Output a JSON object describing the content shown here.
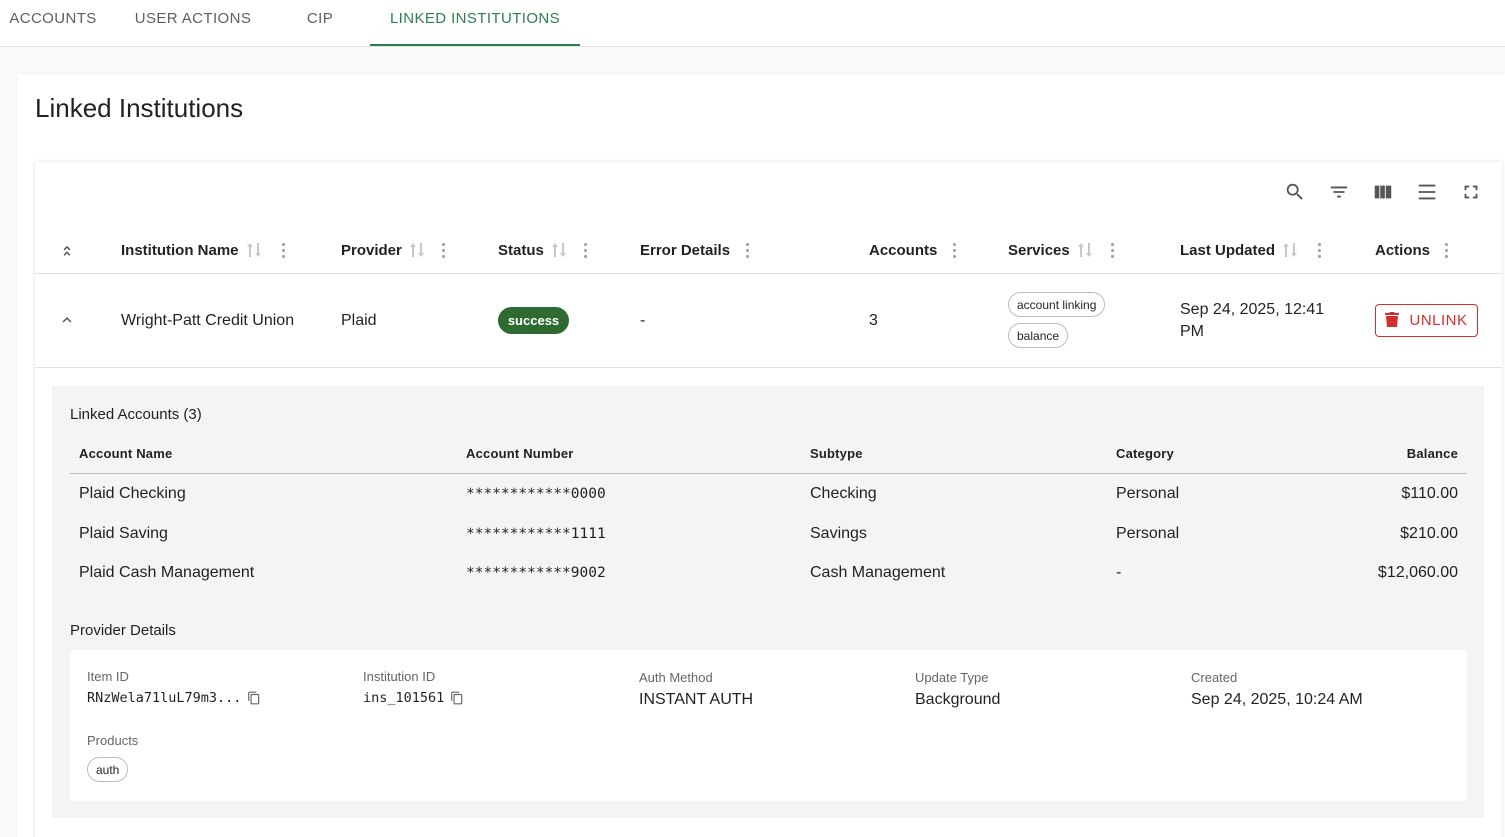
{
  "tabs": [
    {
      "label": "ACCOUNTS"
    },
    {
      "label": "USER ACTIONS"
    },
    {
      "label": "CIP"
    },
    {
      "label": "LINKED INSTITUTIONS"
    }
  ],
  "active_tab": "LINKED INSTITUTIONS",
  "accent_color": "#2e7d4f",
  "page": {
    "title": "Linked Institutions"
  },
  "toolbar": [
    "search-icon",
    "filter-icon",
    "columns-icon",
    "density-icon",
    "fullscreen-icon"
  ],
  "table": {
    "columns": [
      "Institution Name",
      "Provider",
      "Status",
      "Error Details",
      "Accounts",
      "Services",
      "Last Updated",
      "Actions"
    ],
    "row": {
      "institution_name": "Wright-Patt Credit Union",
      "provider": "Plaid",
      "status": "success",
      "error_details": "-",
      "accounts": "3",
      "services": [
        "account linking",
        "balance"
      ],
      "last_updated_line1": "Sep 24, 2025, 12:41",
      "last_updated_line2": "PM",
      "action_label": "UNLINK"
    }
  },
  "linked_accounts": {
    "title": "Linked Accounts (3)",
    "columns": [
      "Account Name",
      "Account Number",
      "Subtype",
      "Category",
      "Balance"
    ],
    "rows": [
      {
        "name": "Plaid Checking",
        "number": "************0000",
        "subtype": "Checking",
        "category": "Personal",
        "balance": "$110.00"
      },
      {
        "name": "Plaid Saving",
        "number": "************1111",
        "subtype": "Savings",
        "category": "Personal",
        "balance": "$210.00"
      },
      {
        "name": "Plaid Cash Management",
        "number": "************9002",
        "subtype": "Cash Management",
        "category": "-",
        "balance": "$12,060.00"
      }
    ]
  },
  "provider_details": {
    "title": "Provider Details",
    "item_id_label": "Item ID",
    "item_id": "RNzWela71luL79m3...",
    "institution_id_label": "Institution ID",
    "institution_id": "ins_101561",
    "auth_method_label": "Auth Method",
    "auth_method": "INSTANT AUTH",
    "update_type_label": "Update Type",
    "update_type": "Background",
    "created_label": "Created",
    "created": "Sep 24, 2025, 10:24 AM",
    "products_label": "Products",
    "products": [
      "auth"
    ]
  }
}
